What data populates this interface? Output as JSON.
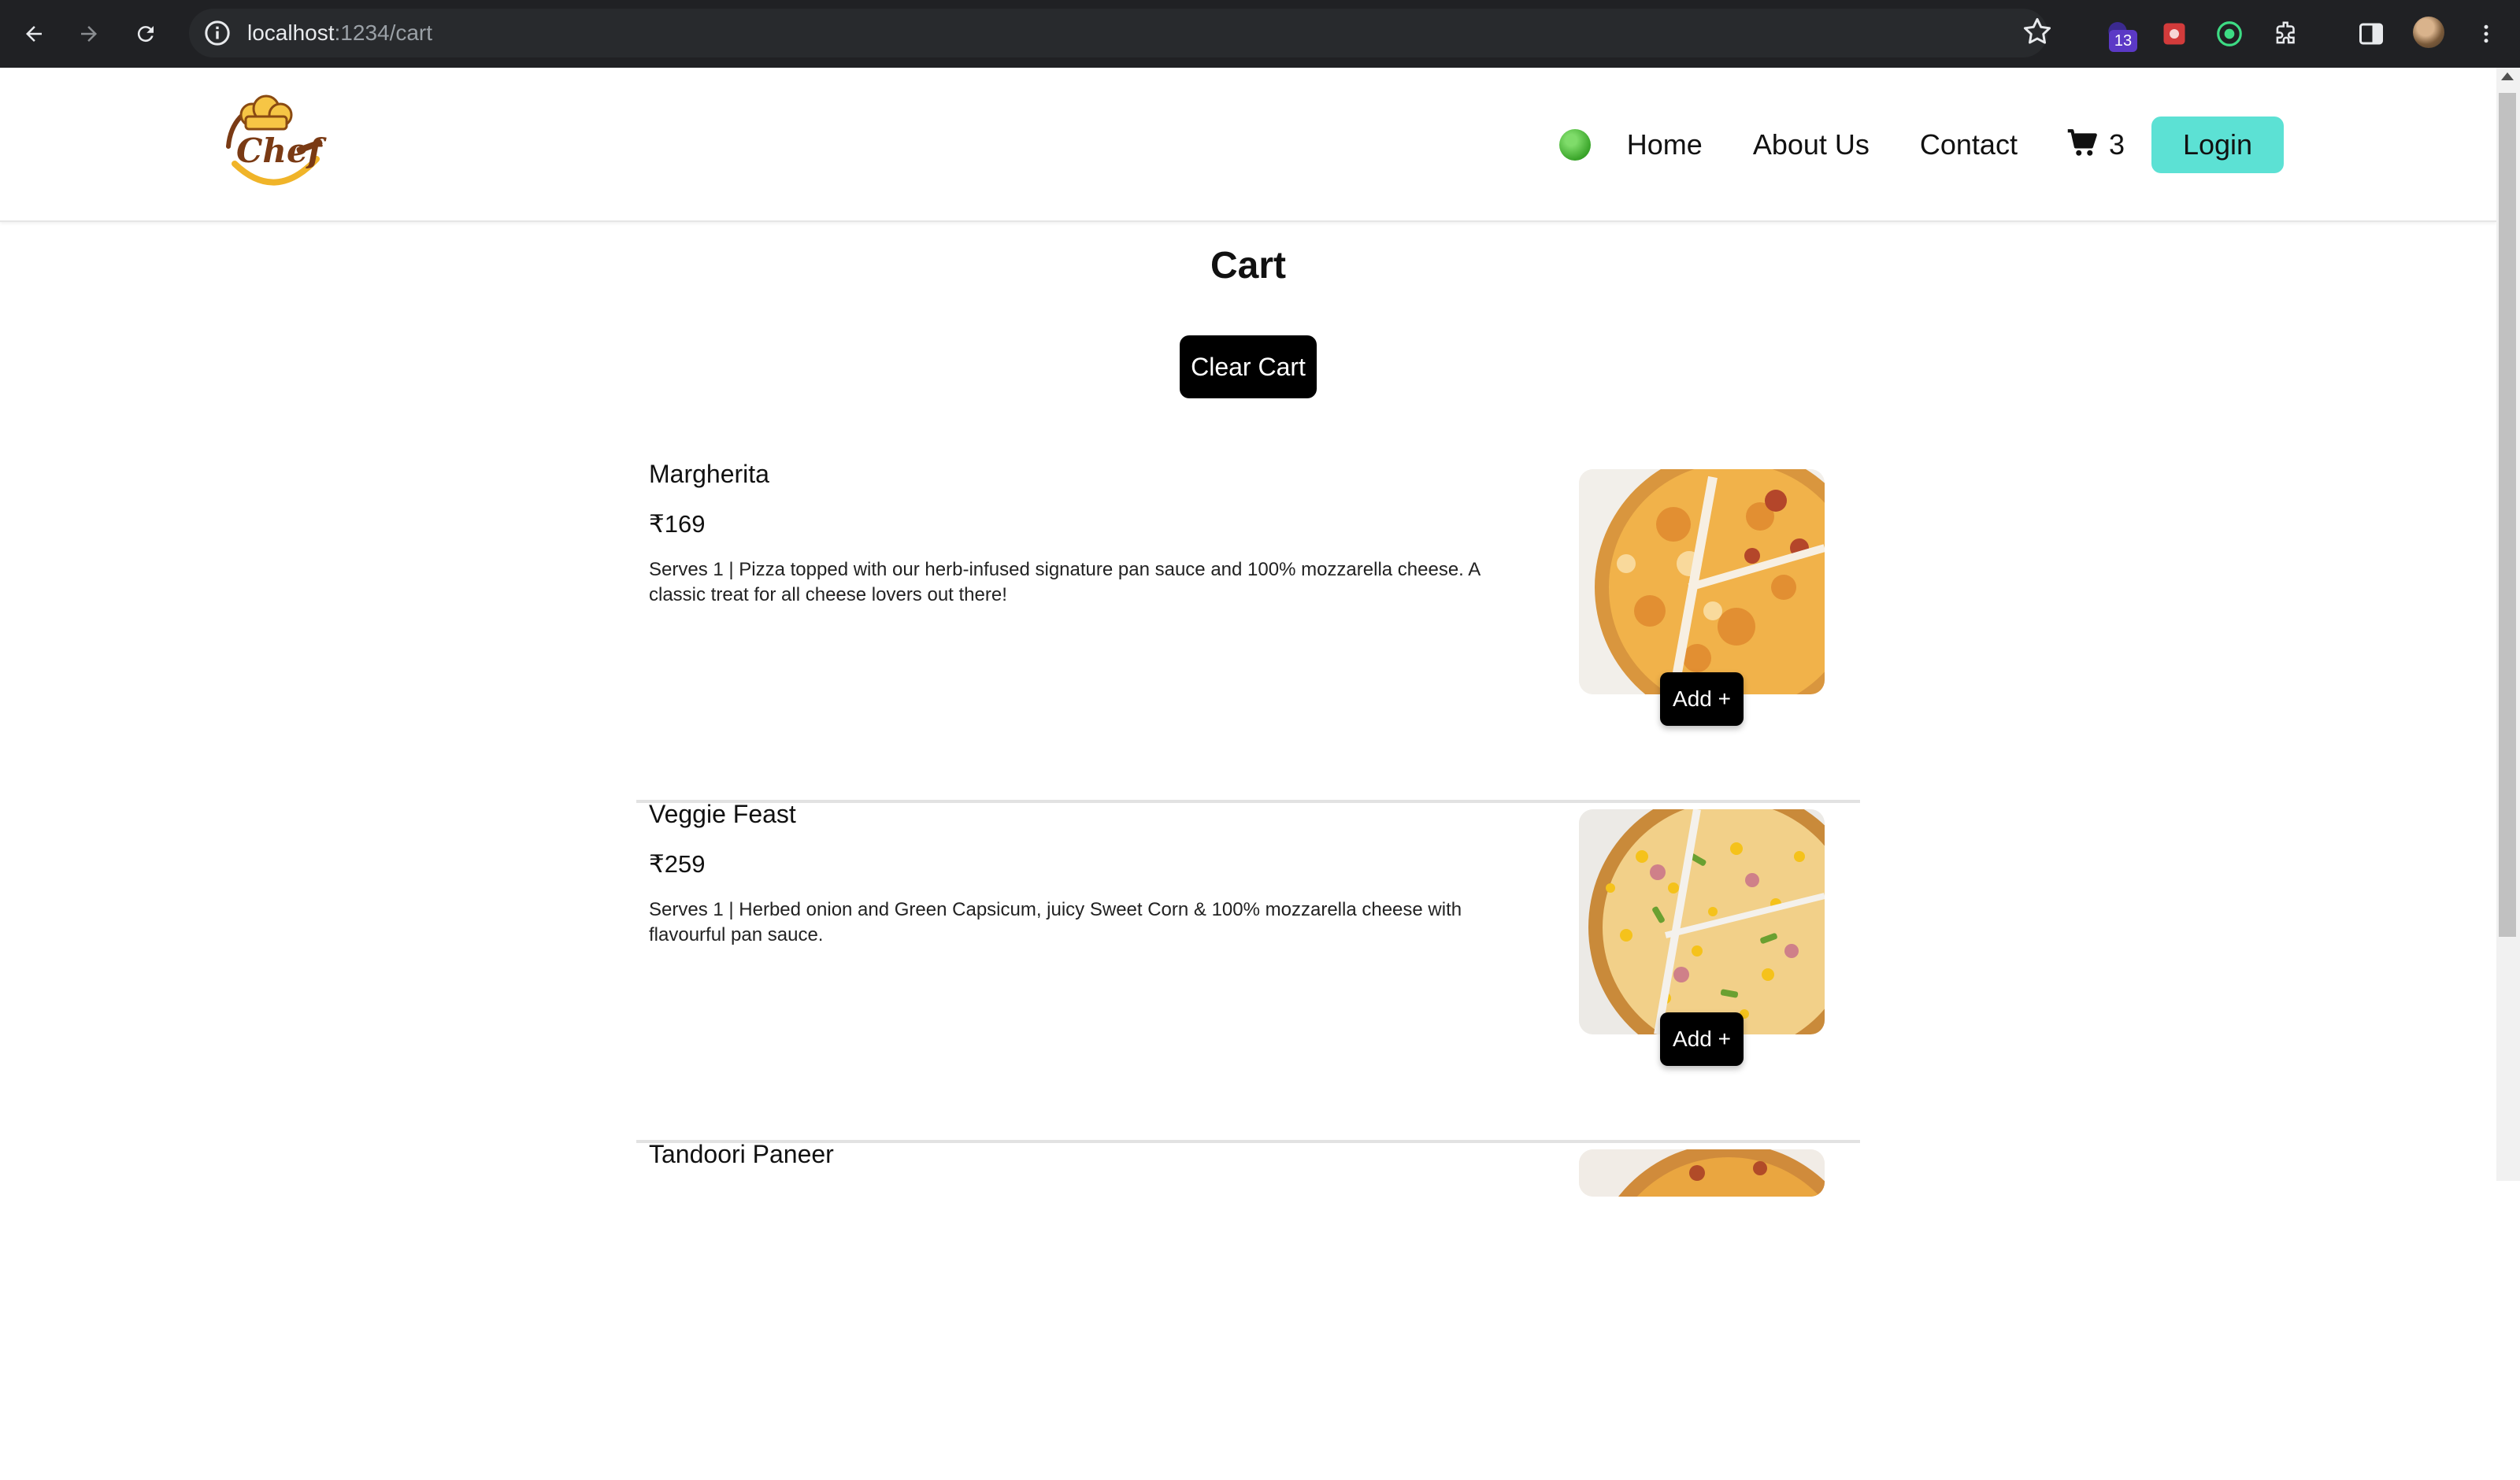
{
  "browser": {
    "url_host": "localhost",
    "url_path": ":1234/cart",
    "extension_badge": "13"
  },
  "header": {
    "nav": {
      "home": "Home",
      "about": "About Us",
      "contact": "Contact",
      "cart_count": "3",
      "login": "Login"
    }
  },
  "main": {
    "title": "Cart",
    "clear_button": "Clear Cart",
    "items": [
      {
        "name": "Margherita",
        "price": "₹169",
        "description": "Serves 1 | Pizza topped with our herb-infused signature pan sauce and 100% mozzarella cheese. A classic treat for all cheese lovers out there!",
        "add_label": "Add +"
      },
      {
        "name": "Veggie Feast",
        "price": "₹259",
        "description": "Serves 1 | Herbed onion and Green Capsicum, juicy Sweet Corn & 100% mozzarella cheese with flavourful pan sauce.",
        "add_label": "Add +"
      },
      {
        "name": "Tandoori Paneer",
        "price": "",
        "description": "",
        "add_label": ""
      }
    ]
  },
  "colors": {
    "login_bg": "#5ce1d4",
    "button_dark": "#000000",
    "status_online": "#3aa52a"
  }
}
